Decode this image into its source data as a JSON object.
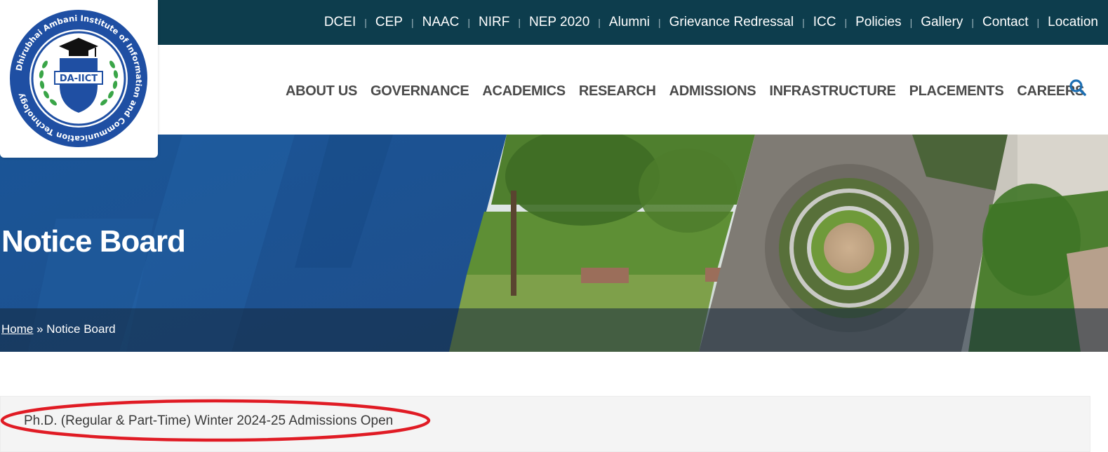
{
  "site": {
    "logo": {
      "ring_text": "Dhirubhai Ambani Institute of Information and Communication Technology",
      "shield_text": "DA-IICT"
    }
  },
  "topbar": {
    "links": [
      "DCEI",
      "CEP",
      "NAAC",
      "NIRF",
      "NEP 2020",
      "Alumni",
      "Grievance Redressal",
      "ICC",
      "Policies",
      "Gallery",
      "Contact",
      "Location"
    ]
  },
  "mainnav": {
    "items": [
      "ABOUT US",
      "GOVERNANCE",
      "ACADEMICS",
      "RESEARCH",
      "ADMISSIONS",
      "INFRASTRUCTURE",
      "PLACEMENTS",
      "CAREERS"
    ],
    "search_icon": "search-icon"
  },
  "hero": {
    "title": "Notice Board",
    "breadcrumb": {
      "home": "Home",
      "separator": "»",
      "current": "Notice Board"
    }
  },
  "notices": [
    {
      "title": "Ph.D. (Regular & Part-Time) Winter 2024-25 Admissions Open",
      "highlighted": true
    }
  ],
  "colors": {
    "topbar_bg": "#0d3d4d",
    "hero_blue": "#1f5ea0",
    "nav_text": "#4a4a4a",
    "search_icon": "#1d6fb3",
    "highlight": "#e01b24",
    "logo_blue": "#1f4fa3",
    "logo_green": "#3aa548"
  }
}
